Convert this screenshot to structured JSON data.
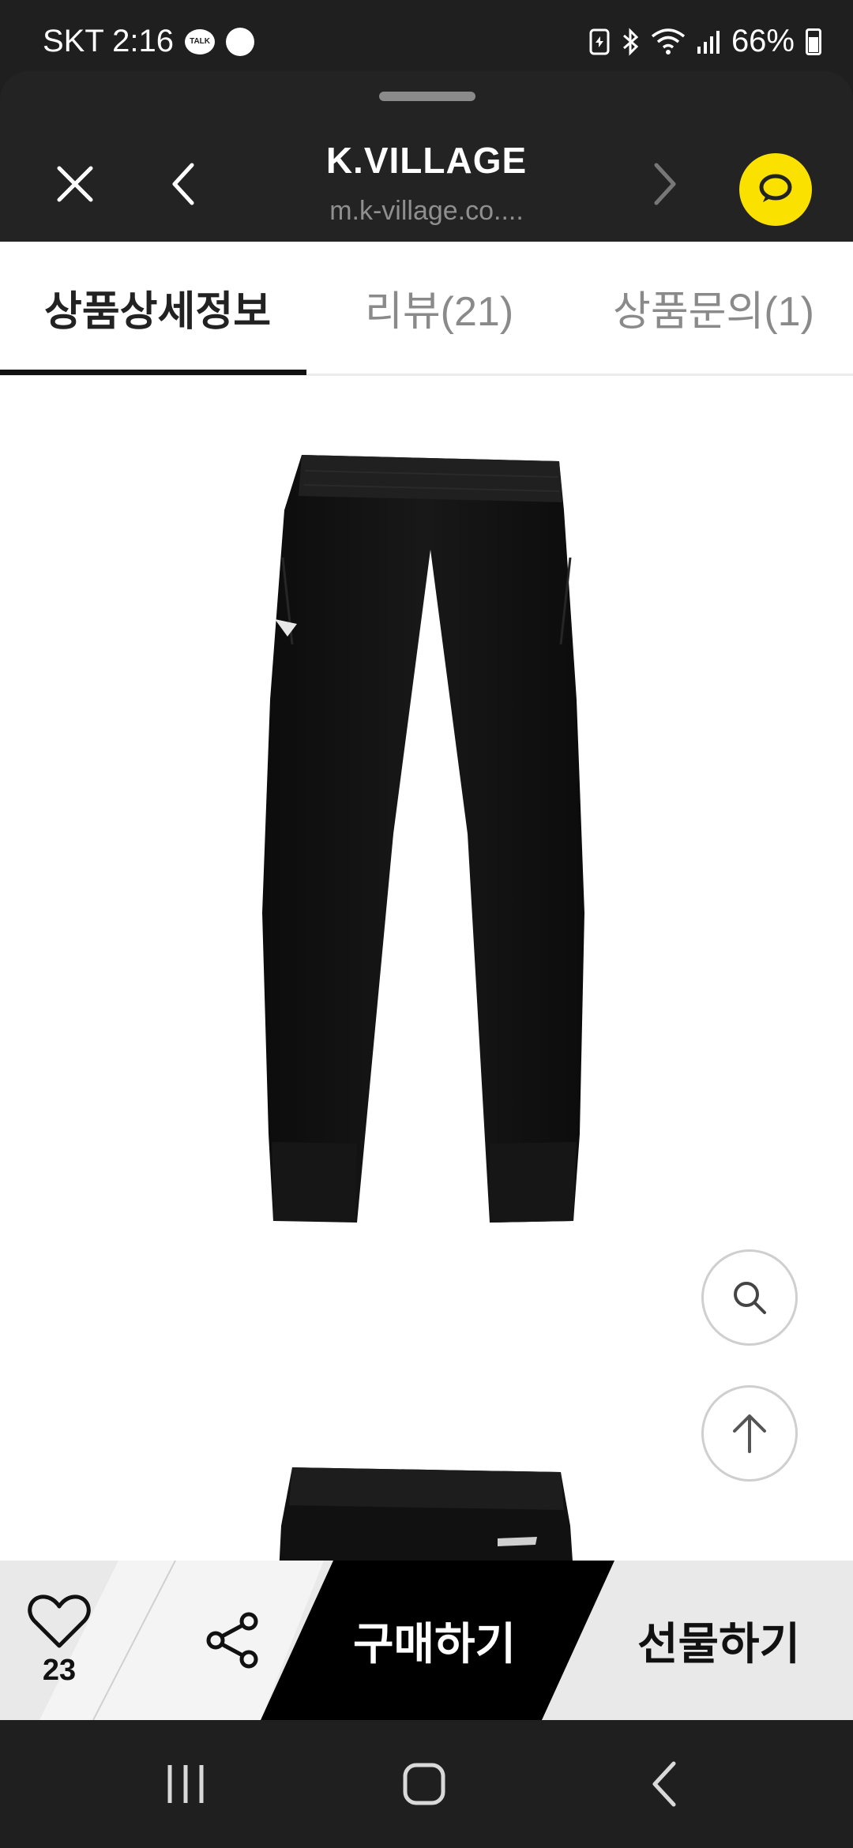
{
  "status_bar": {
    "carrier_time": "SKT 2:16",
    "talk_badge": "TALK",
    "battery": "66%"
  },
  "browser": {
    "title": "K.VILLAGE",
    "url": "m.k-village.co...."
  },
  "tabs": [
    {
      "label": "상품상세정보",
      "active": true
    },
    {
      "label": "리뷰(21)",
      "active": false
    },
    {
      "label": "상품문의(1)",
      "active": false
    }
  ],
  "action_bar": {
    "like_count": "23",
    "buy_label": "구매하기",
    "gift_label": "선물하기"
  },
  "colors": {
    "kakao_yellow": "#fae100",
    "buy_bg": "#000000",
    "bar_bg": "#e9e9e9"
  },
  "icons": {
    "close": "close-icon",
    "back": "chevron-left-icon",
    "forward": "chevron-right-icon",
    "chat": "kakao-chat-icon",
    "zoom": "search-icon",
    "top": "arrow-up-icon",
    "like": "heart-icon",
    "share": "share-icon"
  }
}
